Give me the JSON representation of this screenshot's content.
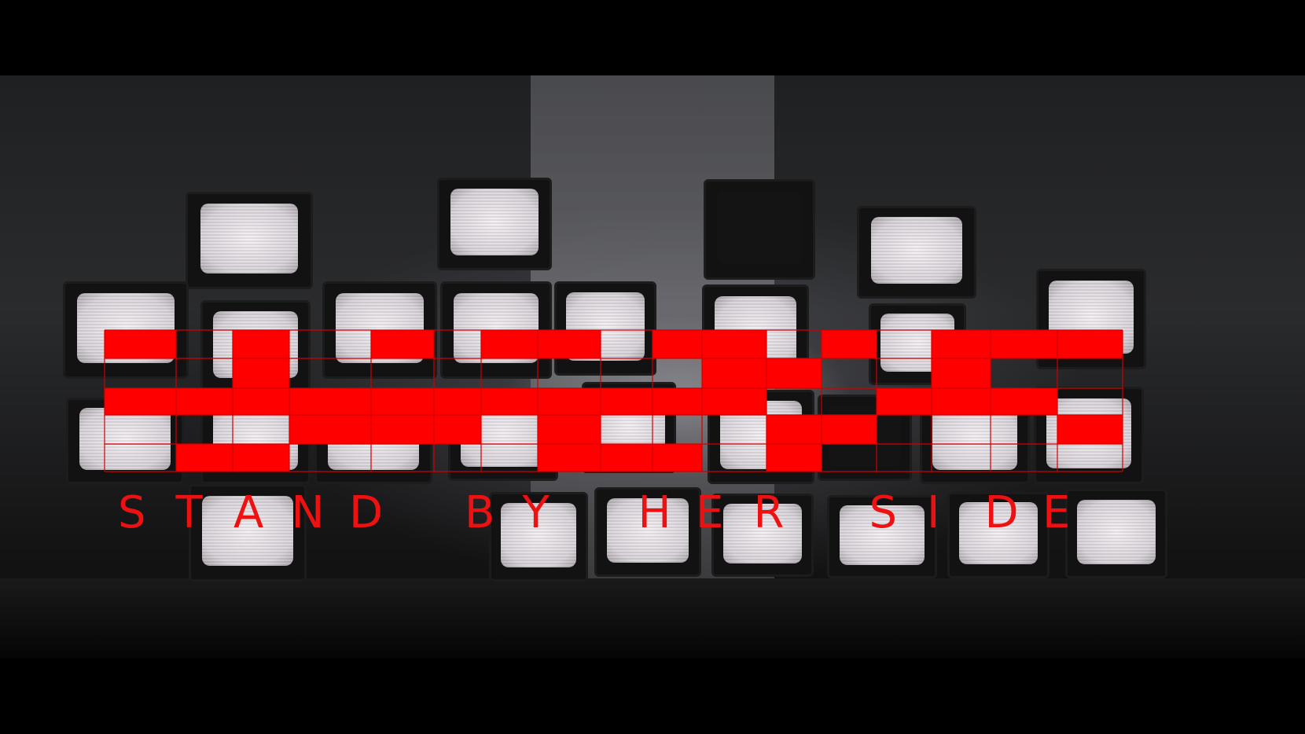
{
  "caption": {
    "text": "STAND BY HER SIDE",
    "color": "#ee1111"
  },
  "overlay": {
    "fill_color": "#ff0000",
    "line_color": "#d00000"
  }
}
